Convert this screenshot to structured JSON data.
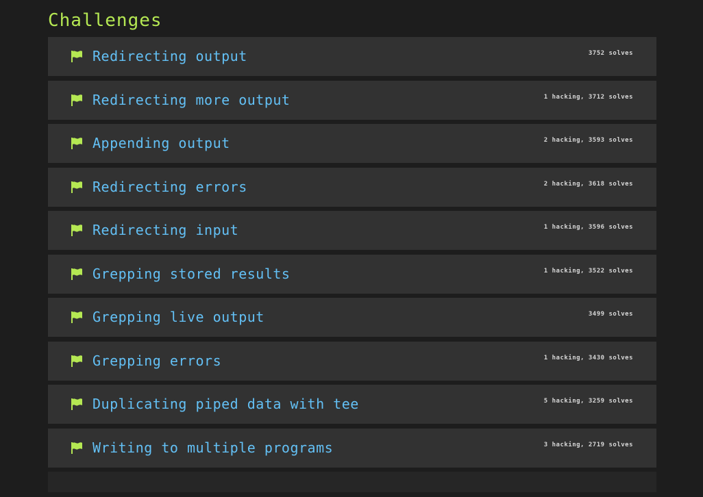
{
  "title": "Challenges",
  "colors": {
    "accent": "#b5e853",
    "link": "#63c0f5",
    "row_bg": "#323232",
    "page_bg": "#1d1d1d"
  },
  "challenges": [
    {
      "name": "Redirecting output",
      "stats": "3752 solves",
      "icon": "flag-icon"
    },
    {
      "name": "Redirecting more output",
      "stats": "1 hacking, 3712 solves",
      "icon": "flag-icon"
    },
    {
      "name": "Appending output",
      "stats": "2 hacking, 3593 solves",
      "icon": "flag-icon"
    },
    {
      "name": "Redirecting errors",
      "stats": "2 hacking, 3618 solves",
      "icon": "flag-icon"
    },
    {
      "name": "Redirecting input",
      "stats": "1 hacking, 3596 solves",
      "icon": "flag-icon"
    },
    {
      "name": "Grepping stored results",
      "stats": "1 hacking, 3522 solves",
      "icon": "flag-icon"
    },
    {
      "name": "Grepping live output",
      "stats": "3499 solves",
      "icon": "flag-icon"
    },
    {
      "name": "Grepping errors",
      "stats": "1 hacking, 3430 solves",
      "icon": "flag-icon"
    },
    {
      "name": "Duplicating piped data with tee",
      "stats": "5 hacking, 3259 solves",
      "icon": "flag-icon"
    },
    {
      "name": "Writing to multiple programs",
      "stats": "3 hacking, 2719 solves",
      "icon": "flag-icon"
    }
  ]
}
